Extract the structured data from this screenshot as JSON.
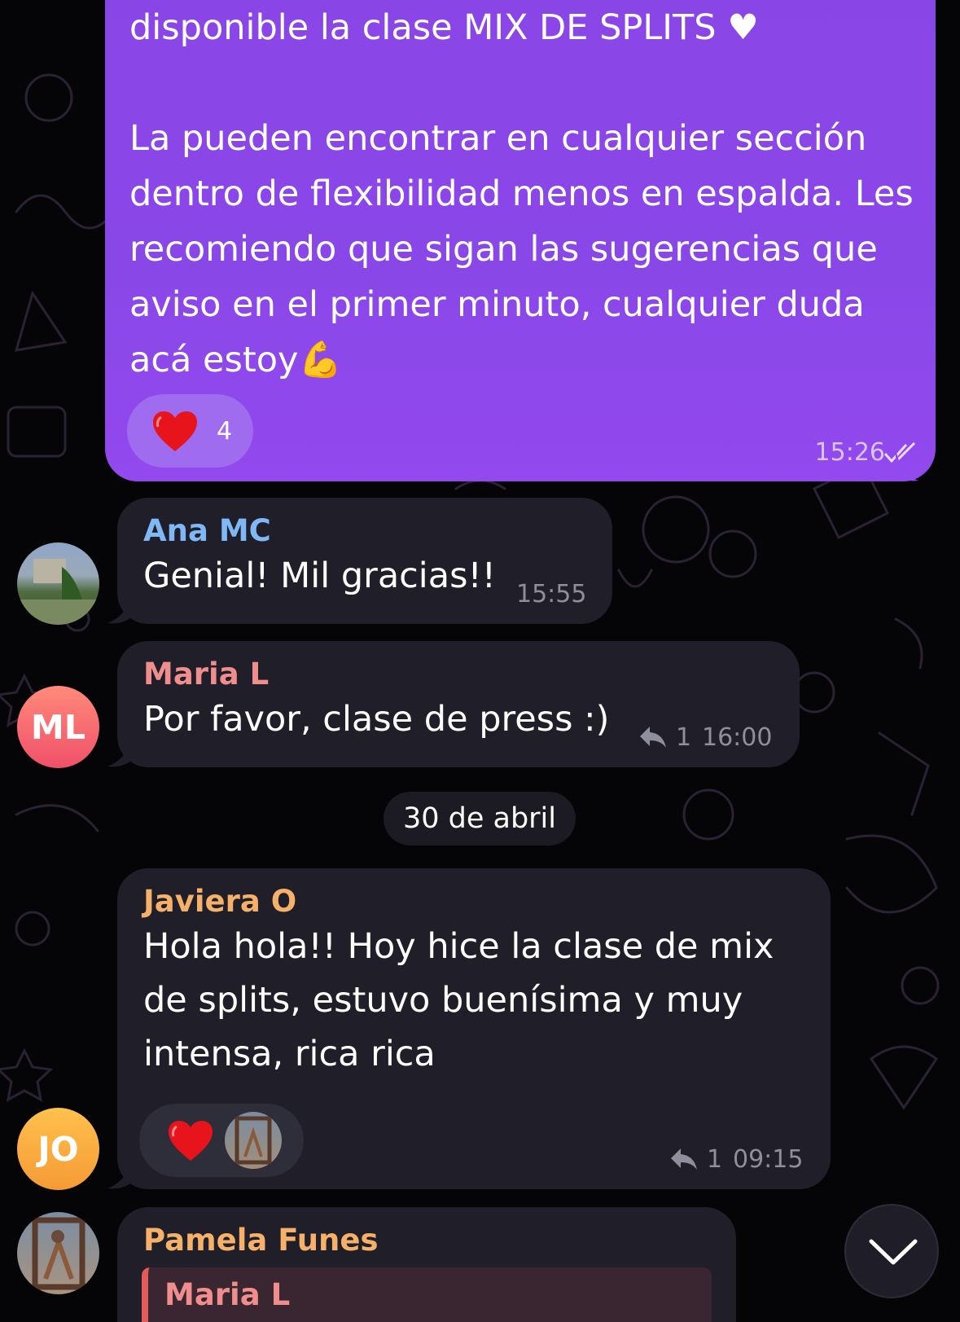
{
  "messages": {
    "outgoing": {
      "text": "disponible la clase MIX DE SPLITS ♥\n\nLa pueden encontrar en cualquier sección dentro de flexibilidad menos en espalda. Les recomiendo que sigan las sugerencias que aviso en el primer minuto, cualquier duda acá estoy💪",
      "reaction_count": "4",
      "time": "15:26"
    },
    "ana": {
      "sender": "Ana MC",
      "text": "Genial! Mil gracias!!",
      "time": "15:55"
    },
    "maria": {
      "sender": "Maria L",
      "text": "Por favor, clase de press :)",
      "reply_count": "1",
      "time": "16:00",
      "avatar_initials": "ML"
    },
    "date_separator": "30 de abril",
    "javiera": {
      "sender": "Javiera O",
      "text": "Hola hola!! Hoy hice la clase de mix de splits, estuvo buenísima y muy intensa, rica rica",
      "reply_count": "1",
      "time": "09:15",
      "avatar_initials": "JO"
    },
    "pamela": {
      "sender": "Pamela Funes",
      "quoted_sender": "Maria L"
    }
  },
  "colors": {
    "outgoing_bubble": "#8a47e8",
    "incoming_bubble": "#1f1e29",
    "ana_name": "#7fb8f5",
    "maria_name": "#f08e8e",
    "javiera_name": "#f5b06a",
    "pamela_name": "#f5b06a",
    "quote_bar": "#e25a5a"
  },
  "icons": {
    "reaction": "red-heart-icon",
    "read_receipt": "double-check-icon",
    "reply": "reply-arrow-icon",
    "scroll": "chevron-down-icon"
  }
}
